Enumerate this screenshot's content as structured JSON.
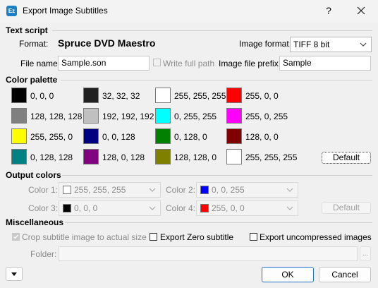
{
  "window": {
    "title": "Export Image Subtitles",
    "app_icon_text": "Ez",
    "help": "?",
    "close": "✕"
  },
  "text_script": {
    "header": "Text script",
    "format_label": "Format:",
    "format_value": "Spruce DVD Maestro",
    "image_format_label": "Image format:",
    "image_format_value": "TIFF 8 bit",
    "file_name_label": "File name:",
    "file_name_value": "Sample.son",
    "write_full_path_label": "Write full path",
    "prefix_label": "Image file prefix:",
    "prefix_value": "Sample"
  },
  "palette": {
    "header": "Color palette",
    "default_button": "Default",
    "rows": [
      [
        {
          "color": "#000000",
          "label": "0, 0, 0"
        },
        {
          "color": "#202020",
          "label": "32, 32, 32"
        },
        {
          "color": "#ffffff",
          "label": "255, 255, 255"
        },
        {
          "color": "#ff0000",
          "label": "255, 0, 0"
        }
      ],
      [
        {
          "color": "#808080",
          "label": "128, 128, 128"
        },
        {
          "color": "#c0c0c0",
          "label": "192, 192, 192"
        },
        {
          "color": "#00ffff",
          "label": "0, 255, 255"
        },
        {
          "color": "#ff00ff",
          "label": "255, 0, 255"
        }
      ],
      [
        {
          "color": "#ffff00",
          "label": "255, 255, 0"
        },
        {
          "color": "#000080",
          "label": "0, 0, 128"
        },
        {
          "color": "#008000",
          "label": "0, 128, 0"
        },
        {
          "color": "#800000",
          "label": "128, 0, 0"
        }
      ],
      [
        {
          "color": "#008080",
          "label": "0, 128, 128"
        },
        {
          "color": "#800080",
          "label": "128, 0, 128"
        },
        {
          "color": "#808000",
          "label": "128, 128, 0"
        },
        {
          "color": "#ffffff",
          "label": "255, 255, 255"
        }
      ]
    ]
  },
  "output_colors": {
    "header": "Output colors",
    "color1_label": "Color 1:",
    "color1_value": "255, 255, 255",
    "color1_swatch": "#ffffff",
    "color2_label": "Color 2:",
    "color2_value": "0, 0, 255",
    "color2_swatch": "#0000ff",
    "color3_label": "Color 3:",
    "color3_value": "0, 0, 0",
    "color3_swatch": "#000000",
    "color4_label": "Color 4:",
    "color4_value": "255, 0, 0",
    "color4_swatch": "#ff0000",
    "default_button": "Default"
  },
  "misc": {
    "header": "Miscellaneous",
    "crop_label": "Crop subtitle image to actual size",
    "export_zero_label": "Export Zero subtitle",
    "export_uncompressed_label": "Export uncompressed images",
    "folder_label": "Folder:",
    "folder_value": "",
    "browse_label": "..."
  },
  "footer": {
    "ok": "OK",
    "cancel": "Cancel"
  }
}
